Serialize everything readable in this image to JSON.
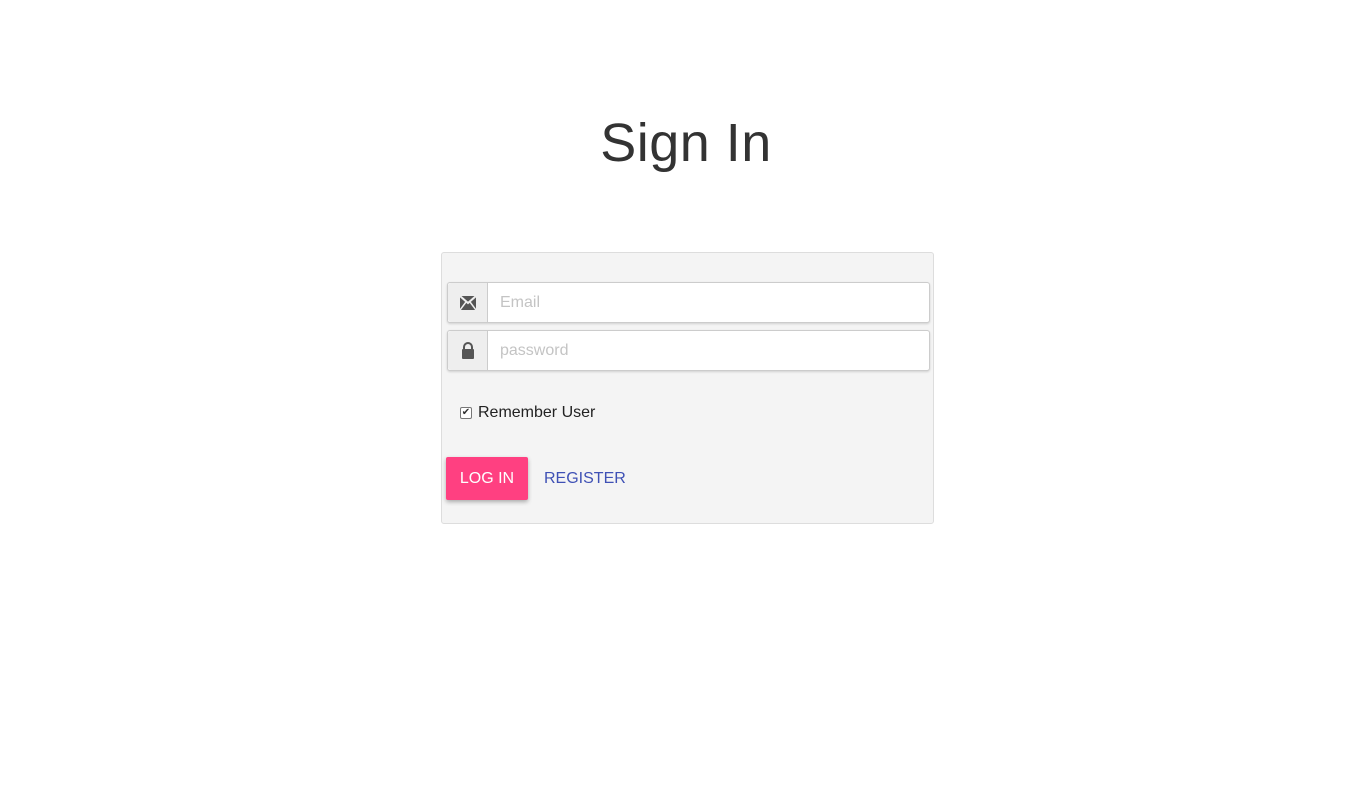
{
  "page": {
    "title": "Sign In"
  },
  "form": {
    "email": {
      "placeholder": "Email",
      "value": "",
      "icon": "envelope-icon"
    },
    "password": {
      "placeholder": "password",
      "value": "",
      "icon": "lock-icon"
    },
    "remember": {
      "label": "Remember User",
      "checked": true
    },
    "login_label": "LOG IN",
    "register_label": "REGISTER"
  },
  "colors": {
    "accent": "#ff4081",
    "link": "#3f51b5",
    "panel_bg": "#f4f4f4"
  }
}
